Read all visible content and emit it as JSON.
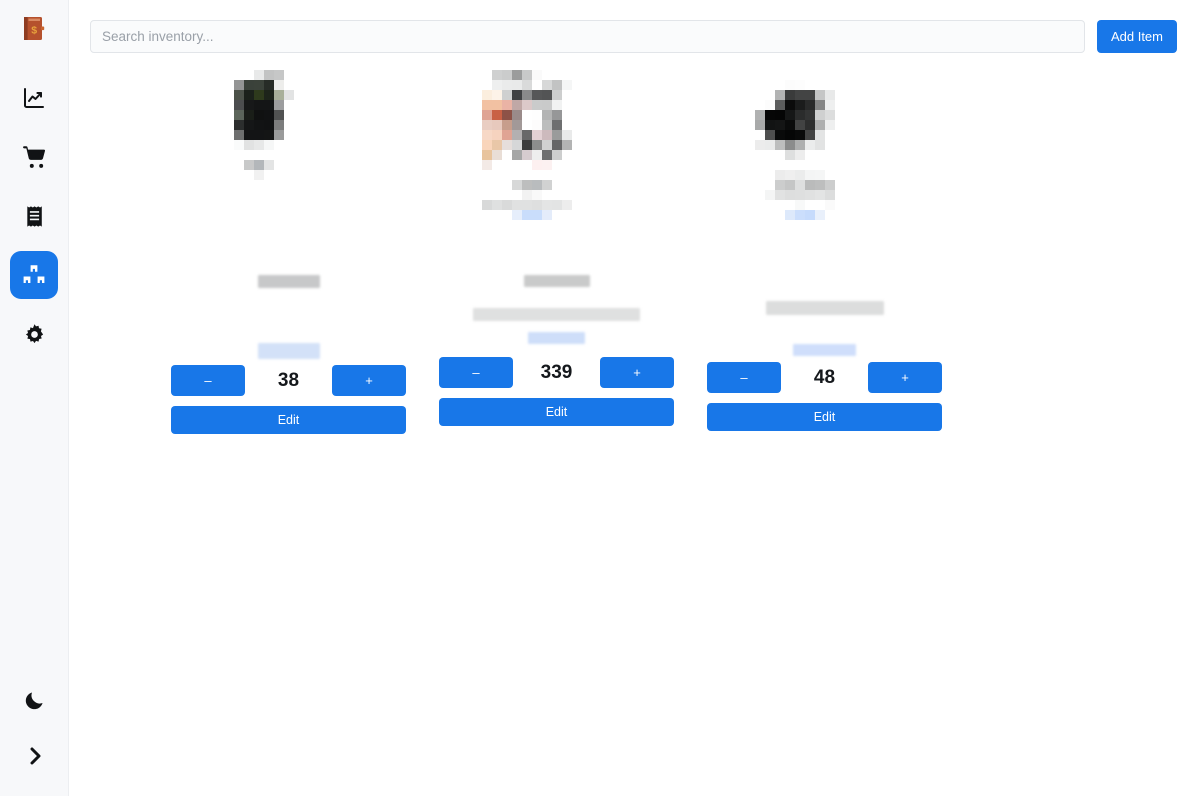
{
  "app": {
    "logo_icon": "ledger-book-dollar-icon",
    "accent_color": "#1877e8",
    "sidebar_bg": "#f7f8fa",
    "main_bg": "#ffffff"
  },
  "sidebar": {
    "items": [
      {
        "icon": "chart-line-up-icon",
        "name": "reports",
        "active": false
      },
      {
        "icon": "shopping-cart-icon",
        "name": "sales",
        "active": false
      },
      {
        "icon": "receipt-icon",
        "name": "expenses",
        "active": false
      },
      {
        "icon": "boxes-inventory-icon",
        "name": "inventory",
        "active": true
      },
      {
        "icon": "gear-icon",
        "name": "settings",
        "active": false
      }
    ],
    "bottom": [
      {
        "icon": "moon-icon",
        "name": "dark-mode-toggle"
      },
      {
        "icon": "chevron-right-icon",
        "name": "expand-sidebar-toggle"
      }
    ]
  },
  "toolbar": {
    "search_value": "",
    "search_placeholder": "Search inventory...",
    "add_item_label": "Add Item"
  },
  "cards": [
    {
      "name": "inventory-item-1",
      "quantity": "38",
      "decrement_label": "–",
      "increment_label": "+",
      "edit_label": "Edit",
      "image": "redacted-pixelated-product-photo-dark",
      "title_redacted": true,
      "desc_redacted": true,
      "price_redacted": true
    },
    {
      "name": "inventory-item-2",
      "quantity": "339",
      "decrement_label": "–",
      "increment_label": "+",
      "edit_label": "Edit",
      "image": "redacted-pixelated-product-photo-warm",
      "title_redacted": true,
      "desc_redacted": true,
      "price_redacted": true
    },
    {
      "name": "inventory-item-3",
      "quantity": "48",
      "decrement_label": "–",
      "increment_label": "+",
      "edit_label": "Edit",
      "image": "redacted-pixelated-product-photo-black",
      "title_redacted": true,
      "desc_redacted": true,
      "price_redacted": true
    }
  ]
}
